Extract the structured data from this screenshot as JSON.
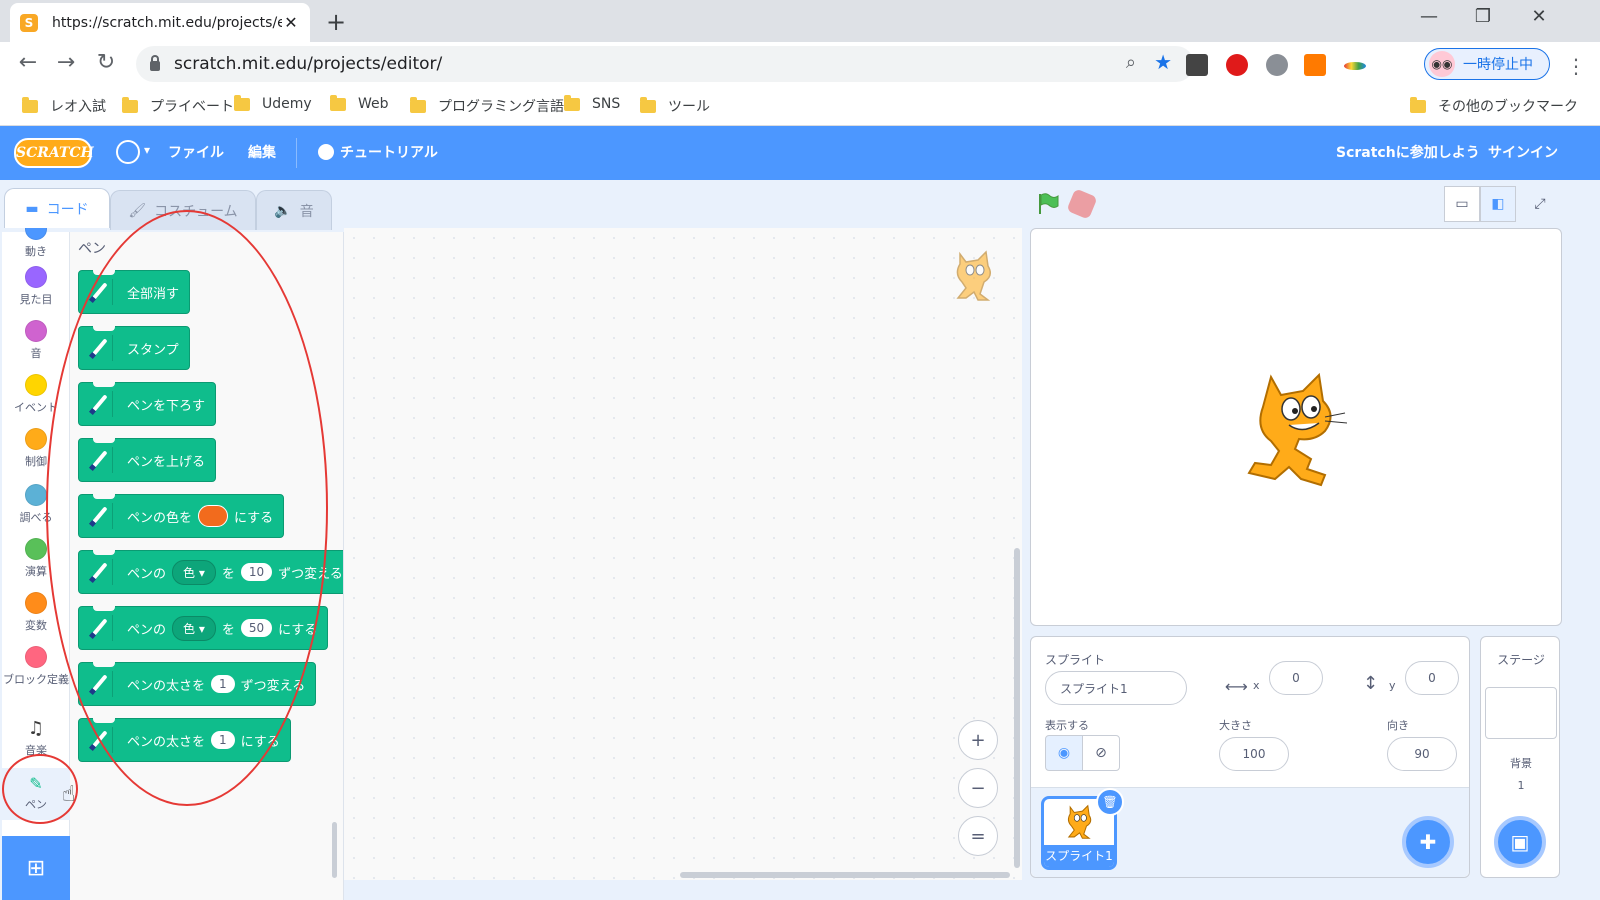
{
  "browser": {
    "tab_title": "https://scratch.mit.edu/projects/e",
    "tab_close": "✕",
    "new_tab": "+",
    "favicon": "S",
    "url": "scratch.mit.edu/projects/editor/",
    "profile_label": "一時停止中",
    "win_minimize": "—",
    "win_restore": "❐",
    "win_close": "✕"
  },
  "bookmarks": [
    {
      "label": "レオ入試"
    },
    {
      "label": "プライベート"
    },
    {
      "label": "Udemy"
    },
    {
      "label": "Web"
    },
    {
      "label": "プログラミング言語"
    },
    {
      "label": "SNS"
    },
    {
      "label": "ツール"
    },
    {
      "label": "その他のブックマーク"
    }
  ],
  "menu": {
    "logo": "SCRATCH",
    "file": "ファイル",
    "edit": "編集",
    "tutorial": "チュートリアル",
    "join": "Scratchに参加しよう",
    "signin": "サインイン"
  },
  "editor_tabs": {
    "code": "コード",
    "costumes": "コスチューム",
    "sounds": "音"
  },
  "categories": [
    {
      "label": "動き",
      "color": "#4c97ff"
    },
    {
      "label": "見た目",
      "color": "#9966ff"
    },
    {
      "label": "音",
      "color": "#cf63cf"
    },
    {
      "label": "イベント",
      "color": "#ffd500"
    },
    {
      "label": "制御",
      "color": "#ffab19"
    },
    {
      "label": "調べる",
      "color": "#5cb1d6"
    },
    {
      "label": "演算",
      "color": "#59c059"
    },
    {
      "label": "変数",
      "color": "#ff8c1a"
    },
    {
      "label": "ブロック定義",
      "color": "#ff6680"
    },
    {
      "label": "音楽",
      "icon": "music-note-icon"
    },
    {
      "label": "ペン",
      "icon": "pen-icon"
    }
  ],
  "palette": {
    "title": "ペン",
    "blocks": {
      "clear": "全部消す",
      "stamp": "スタンプ",
      "pen_down": "ペンを下ろす",
      "pen_up": "ペンを上げる",
      "set_color": {
        "prefix": "ペンの色を",
        "suffix": "にする",
        "swatch": "#f26b1d"
      },
      "change_param": {
        "prefix": "ペンの",
        "param": "色",
        "mid": "を",
        "value": "10",
        "suffix": "ずつ変える"
      },
      "set_param": {
        "prefix": "ペンの",
        "param": "色",
        "mid": "を",
        "value": "50",
        "suffix": "にする"
      },
      "change_size": {
        "prefix": "ペンの太さを",
        "value": "1",
        "suffix": "ずつ変える"
      },
      "set_size": {
        "prefix": "ペンの太さを",
        "value": "1",
        "suffix": "にする"
      }
    }
  },
  "zoom": {
    "in": "+",
    "out": "−",
    "reset": "="
  },
  "sprite": {
    "label": "スプライト",
    "name": "スプライト1",
    "x_label": "x",
    "x": "0",
    "y_label": "y",
    "y": "0",
    "show_label": "表示する",
    "size_label": "大きさ",
    "size": "100",
    "direction_label": "向き",
    "direction": "90",
    "thumb_name": "スプライト1"
  },
  "stage_pane": {
    "title": "ステージ",
    "backdrops_label": "背景",
    "backdrops_count": "1"
  },
  "colors": {
    "scratch_blue": "#4c97ff",
    "pen_green": "#0fbd8c",
    "annotation_red": "#e53935"
  }
}
